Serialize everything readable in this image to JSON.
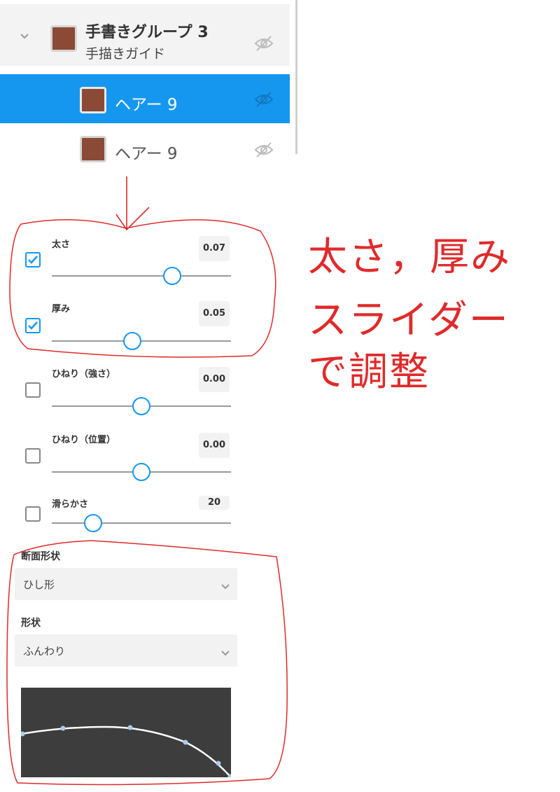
{
  "layers": {
    "group": {
      "name": "手書きグループ 3",
      "subtitle": "手描きガイド"
    },
    "selected": {
      "name": "ヘアー 9"
    },
    "plain": {
      "name": "ヘアー 9"
    },
    "swatch_color": "#8a4a35",
    "selected_color": "#1597f0"
  },
  "settings": {
    "thickness": {
      "label": "太さ",
      "value": "0.07",
      "checked": true,
      "level": 0.67
    },
    "depth": {
      "label": "厚み",
      "value": "0.05",
      "checked": true,
      "level": 0.45
    },
    "twist_strength": {
      "label": "ひねり（強さ）",
      "value": "0.00",
      "checked": false,
      "level": 0.5
    },
    "twist_position": {
      "label": "ひねり（位置）",
      "value": "0.00",
      "checked": false,
      "level": 0.5
    },
    "smoothness": {
      "label": "滑らかさ",
      "value": "20",
      "checked": false,
      "level": 0.23
    }
  },
  "cross_section": {
    "label": "断面形状",
    "value": "ひし形"
  },
  "shape": {
    "label": "形状",
    "value": "ふんわり"
  },
  "annotations": {
    "line1": "太さ，厚み",
    "line2": "スライダー",
    "line3": "で調整",
    "color": "#e02a2a"
  }
}
